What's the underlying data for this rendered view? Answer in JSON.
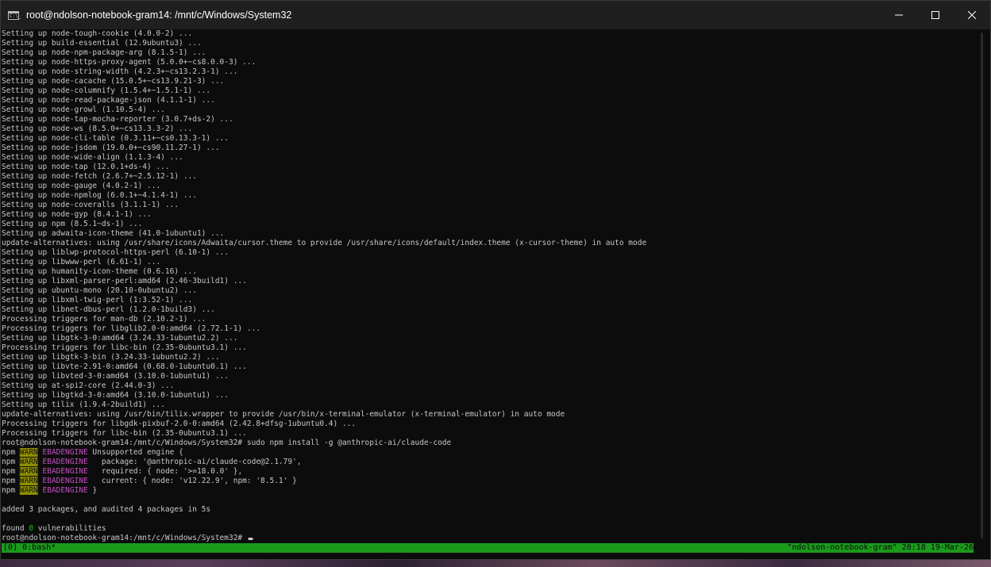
{
  "window": {
    "title": "root@ndolson-notebook-gram14: /mnt/c/Windows/System32",
    "app_icon_glyph": "C:\\_",
    "controls": {
      "minimize_icon": "minimize-icon",
      "maximize_icon": "maximize-icon",
      "close_icon": "close-icon"
    }
  },
  "terminal": {
    "lines_a": [
      "Setting up node-tough-cookie (4.0.0-2) ...",
      "Setting up build-essential (12.9ubuntu3) ...",
      "Setting up node-npm-package-arg (8.1.5-1) ...",
      "Setting up node-https-proxy-agent (5.0.0+~cs8.0.0-3) ...",
      "Setting up node-string-width (4.2.3+~cs13.2.3-1) ...",
      "Setting up node-cacache (15.0.5+~cs13.9.21-3) ...",
      "Setting up node-columnify (1.5.4+~1.5.1-1) ...",
      "Setting up node-read-package-json (4.1.1-1) ...",
      "Setting up node-growl (1.10.5-4) ...",
      "Setting up node-tap-mocha-reporter (3.0.7+ds-2) ...",
      "Setting up node-ws (8.5.0+~cs13.3.3-2) ...",
      "Setting up node-cli-table (0.3.11+~cs0.13.3-1) ...",
      "Setting up node-jsdom (19.0.0+~cs90.11.27-1) ...",
      "Setting up node-wide-align (1.1.3-4) ...",
      "Setting up node-tap (12.0.1+ds-4) ...",
      "Setting up node-fetch (2.6.7+~2.5.12-1) ...",
      "Setting up node-gauge (4.0.2-1) ...",
      "Setting up node-npmlog (6.0.1+~4.1.4-1) ...",
      "Setting up node-coveralls (3.1.1-1) ...",
      "Setting up node-gyp (8.4.1-1) ...",
      "Setting up npm (8.5.1~ds-1) ...",
      "Setting up adwaita-icon-theme (41.0-1ubuntu1) ...",
      "update-alternatives: using /usr/share/icons/Adwaita/cursor.theme to provide /usr/share/icons/default/index.theme (x-cursor-theme) in auto mode",
      "Setting up liblwp-protocol-https-perl (6.10-1) ...",
      "Setting up libwww-perl (6.61-1) ...",
      "Setting up humanity-icon-theme (0.6.16) ...",
      "Setting up libxml-parser-perl:amd64 (2.46-3build1) ...",
      "Setting up ubuntu-mono (20.10-0ubuntu2) ...",
      "Setting up libxml-twig-perl (1:3.52-1) ...",
      "Setting up libnet-dbus-perl (1.2.0-1build3) ...",
      "Processing triggers for man-db (2.10.2-1) ...",
      "Processing triggers for libglib2.0-0:amd64 (2.72.1-1) ...",
      "Setting up libgtk-3-0:amd64 (3.24.33-1ubuntu2.2) ...",
      "Processing triggers for libc-bin (2.35-0ubuntu3.1) ...",
      "Setting up libgtk-3-bin (3.24.33-1ubuntu2.2) ...",
      "Setting up libvte-2.91-0:amd64 (0.68.0-1ubuntu0.1) ...",
      "Setting up libvted-3-0:amd64 (3.10.0-1ubuntu1) ...",
      "Setting up at-spi2-core (2.44.0-3) ...",
      "Setting up libgtkd-3-0:amd64 (3.10.0-1ubuntu1) ...",
      "Setting up tilix (1.9.4-2build1) ...",
      "update-alternatives: using /usr/bin/tilix.wrapper to provide /usr/bin/x-terminal-emulator (x-terminal-emulator) in auto mode",
      "Processing triggers for libgdk-pixbuf-2.0-0:amd64 (2.42.8+dfsg-1ubuntu0.4) ...",
      "Processing triggers for libc-bin (2.35-0ubuntu3.1) ...",
      "root@ndolson-notebook-gram14:/mnt/c/Windows/System32# sudo npm install -g @anthropic-ai/claude-code"
    ],
    "npm_prefix": "npm",
    "npm_warn": "WARN",
    "npm_ebadengine": "EBADENGINE",
    "npm_warn_lines": [
      " Unsupported engine {",
      "   package: '@anthropic-ai/claude-code@2.1.79',",
      "   required: { node: '>=18.0.0' },",
      "   current: { node: 'v12.22.9', npm: '8.5.1' }",
      " }"
    ],
    "blank": "",
    "added_line": "added 3 packages, and audited 4 packages in 5s",
    "found_prefix": "found ",
    "found_count": "0",
    "found_suffix": " vulnerabilities",
    "prompt": "root@ndolson-notebook-gram14:/mnt/c/Windows/System32# "
  },
  "statusbar": {
    "left": "[0] 0:bash*",
    "right": "\"ndolson-notebook-gram\" 20:18 19-Mar-26"
  },
  "colors": {
    "terminal_bg": "#0c0c0c",
    "text": "#c8c8c8",
    "warn_bg": "#8f8f00",
    "ebadengine": "#c150c1",
    "status_green": "#1b9a1b",
    "vuln_green": "#1ec41e"
  }
}
